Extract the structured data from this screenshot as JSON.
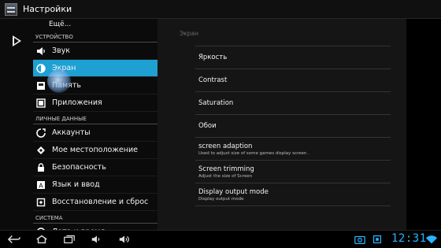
{
  "titlebar": {
    "title": "Настройки"
  },
  "left_menu": {
    "more": "Ещё...",
    "sections": [
      {
        "label": "УСТРОЙСТВО",
        "items": [
          {
            "label": "Звук",
            "icon": "volume-icon"
          },
          {
            "label": "Экран",
            "icon": "brightness-icon",
            "selected": true
          },
          {
            "label": "Память",
            "icon": "storage-icon"
          },
          {
            "label": "Приложения",
            "icon": "apps-icon"
          }
        ]
      },
      {
        "label": "ЛИЧНЫЕ ДАННЫЕ",
        "items": [
          {
            "label": "Аккаунты",
            "icon": "sync-icon"
          },
          {
            "label": "Мое местоположение",
            "icon": "location-icon"
          },
          {
            "label": "Безопасность",
            "icon": "lock-icon"
          },
          {
            "label": "Язык и ввод",
            "icon": "keyboard-icon"
          },
          {
            "label": "Восстановление и сброс",
            "icon": "restore-icon"
          }
        ]
      },
      {
        "label": "СИСТЕМА",
        "items": [
          {
            "label": "Дата и время",
            "icon": "clock-icon"
          }
        ]
      }
    ]
  },
  "display_panel": {
    "header": "Экран",
    "items": [
      {
        "title": "Яркость",
        "subtitle": ""
      },
      {
        "title": "Contrast",
        "subtitle": ""
      },
      {
        "title": "Saturation",
        "subtitle": ""
      },
      {
        "title": "Обои",
        "subtitle": ""
      },
      {
        "title": "screen adaption",
        "subtitle": "Used to adjust size of some games display screen ."
      },
      {
        "title": "Screen trimming",
        "subtitle": "Adjust the size of Screen"
      },
      {
        "title": "Display output mode",
        "subtitle": "Display output mode"
      }
    ]
  },
  "navbar": {
    "time": "12:31",
    "accent": "#28b4ff"
  }
}
